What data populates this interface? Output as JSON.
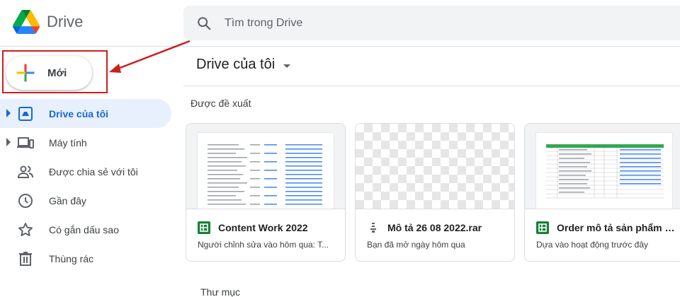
{
  "app": {
    "name": "Drive"
  },
  "search": {
    "placeholder": "Tìm trong Drive"
  },
  "new_button": {
    "label": "Mới"
  },
  "sidebar": {
    "items": [
      {
        "label": "Drive của tôi",
        "icon": "my-drive-icon",
        "active": true
      },
      {
        "label": "Máy tính",
        "icon": "computer-icon"
      },
      {
        "label": "Được chia sẻ với tôi",
        "icon": "shared-people-icon"
      },
      {
        "label": "Gần đây",
        "icon": "clock-icon"
      },
      {
        "label": "Có gắn dấu sao",
        "icon": "star-icon"
      },
      {
        "label": "Thùng rác",
        "icon": "trash-icon"
      }
    ]
  },
  "main": {
    "title": "Drive của tôi",
    "suggested_label": "Được đề xuất",
    "folders_label": "Thư mục",
    "cards": [
      {
        "title": "Content Work 2022",
        "subtitle": "Người chỉnh sửa vào hôm qua: T...",
        "icon": "sheets-icon"
      },
      {
        "title": "Mô tả 26 08 2022.rar",
        "subtitle": "Bạn đã mở ngày hôm qua",
        "icon": "archive-icon"
      },
      {
        "title": "Order mô tả sản phẩm từ...",
        "subtitle": "Dựa vào hoạt động trước đây",
        "icon": "sheets-icon"
      }
    ]
  },
  "colors": {
    "accent": "#1967d2",
    "active_bg": "#e8f0fe",
    "annotation_red": "#cc1f1f",
    "sheets_green": "#188038"
  }
}
